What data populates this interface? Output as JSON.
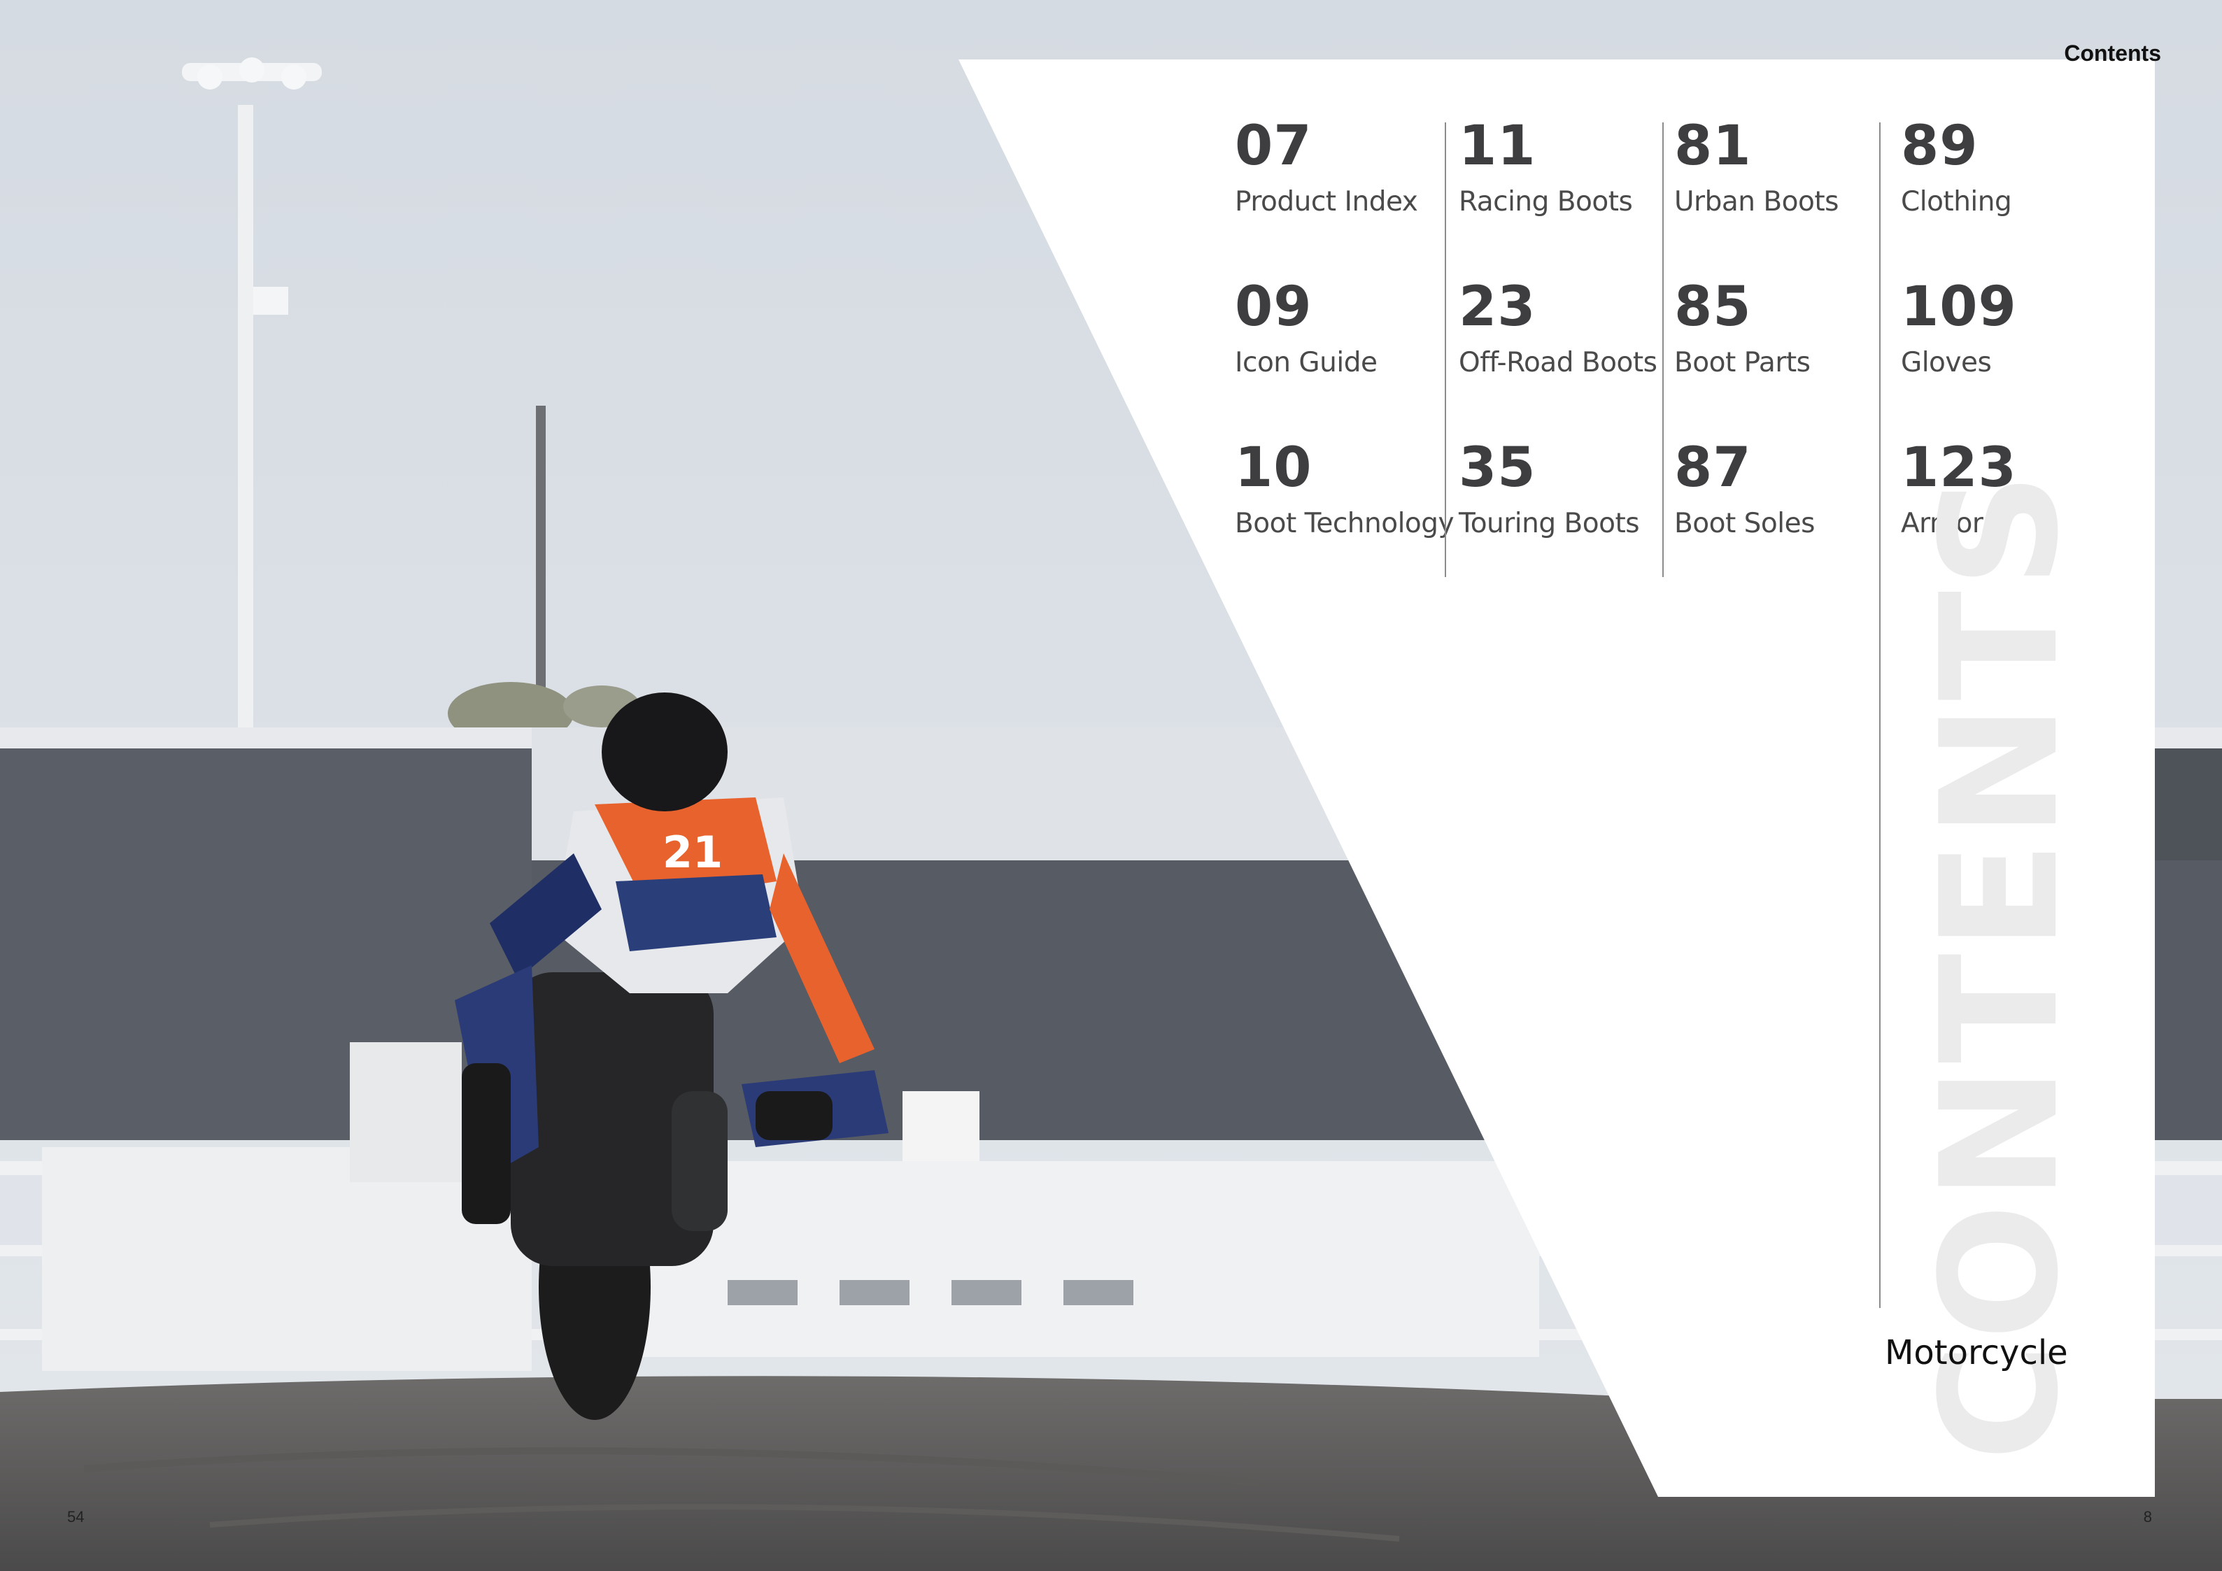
{
  "header": {
    "section_label": "Contents"
  },
  "toc": {
    "columns": [
      {
        "entries": [
          {
            "page": "07",
            "label": "Product Index"
          },
          {
            "page": "09",
            "label": "Icon Guide"
          },
          {
            "page": "10",
            "label": "Boot Technology"
          }
        ]
      },
      {
        "entries": [
          {
            "page": "11",
            "label": "Racing Boots"
          },
          {
            "page": "23",
            "label": "Off-Road Boots"
          },
          {
            "page": "35",
            "label": "Touring Boots"
          }
        ]
      },
      {
        "entries": [
          {
            "page": "81",
            "label": "Urban Boots"
          },
          {
            "page": "85",
            "label": "Boot Parts"
          },
          {
            "page": "87",
            "label": "Boot Soles"
          }
        ]
      },
      {
        "entries": [
          {
            "page": "89",
            "label": "Clothing"
          },
          {
            "page": "109",
            "label": "Gloves"
          },
          {
            "page": "123",
            "label": "Armor"
          }
        ]
      }
    ]
  },
  "watermark": "CONTENTS",
  "section_title": "Motorcycle",
  "page_numbers": {
    "left": "54",
    "right": "8"
  },
  "colors": {
    "number_text": "#3e3e40",
    "label_text": "#4a4a4a",
    "watermark": "#ebebeb",
    "panel": "#ffffff"
  },
  "photo": {
    "subject": "motorcycle-racer-icon",
    "rider_number": "21"
  }
}
